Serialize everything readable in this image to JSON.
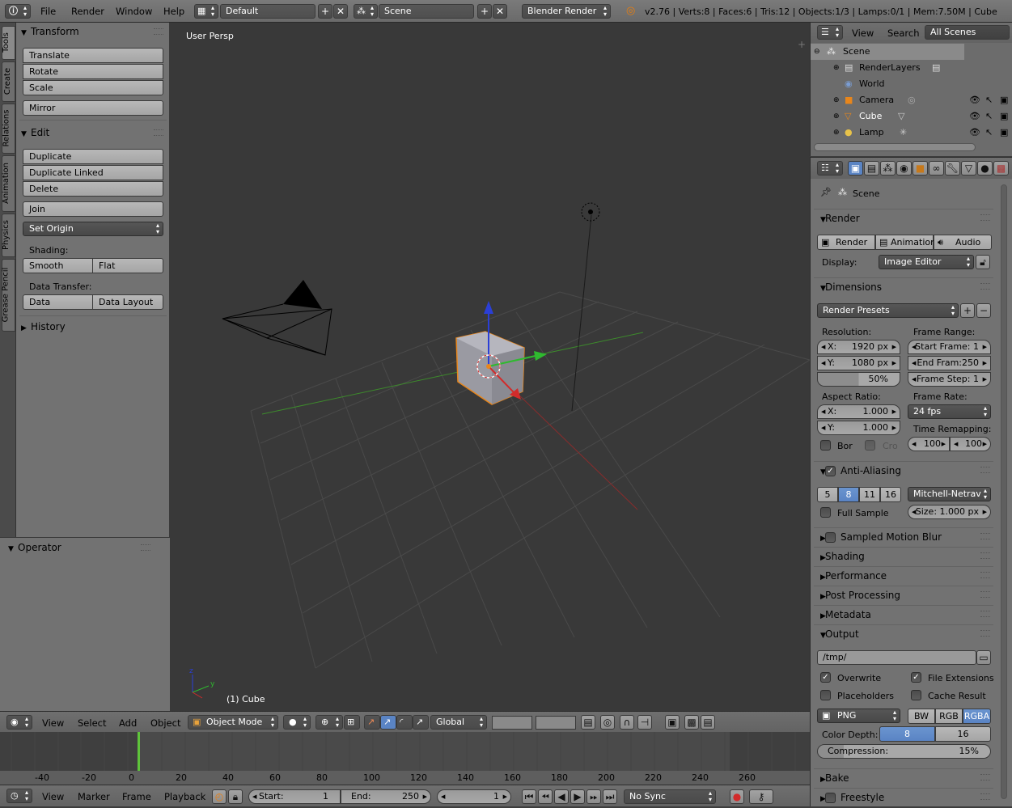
{
  "topbar": {
    "menus": [
      "File",
      "Render",
      "Window",
      "Help"
    ],
    "layout": "Default",
    "scene": "Scene",
    "engine": "Blender Render",
    "stats": "v2.76 | Verts:8 | Faces:6 | Tris:12 | Objects:1/3 | Lamps:0/1 | Mem:7.50M | Cube"
  },
  "left_tabs": [
    "Tools",
    "Create",
    "Relations",
    "Animation",
    "Physics",
    "Grease Pencil"
  ],
  "toolshelf": {
    "transform_title": "Transform",
    "translate": "Translate",
    "rotate": "Rotate",
    "scale": "Scale",
    "mirror": "Mirror",
    "edit_title": "Edit",
    "duplicate": "Duplicate",
    "duplicate_linked": "Duplicate Linked",
    "delete": "Delete",
    "join": "Join",
    "set_origin": "Set Origin",
    "shading_label": "Shading:",
    "smooth": "Smooth",
    "flat": "Flat",
    "data_transfer_label": "Data Transfer:",
    "data": "Data",
    "data_layout": "Data Layout",
    "history_title": "History"
  },
  "operator": {
    "title": "Operator"
  },
  "viewport": {
    "view_name": "User Persp",
    "object_label": "(1) Cube"
  },
  "viewport_header": {
    "menus": [
      "View",
      "Select",
      "Add",
      "Object"
    ],
    "mode": "Object Mode",
    "orientation": "Global"
  },
  "timeline": {
    "ticks": [
      "-40",
      "-20",
      "0",
      "20",
      "40",
      "60",
      "80",
      "100",
      "120",
      "140",
      "160",
      "180",
      "200",
      "220",
      "240",
      "260"
    ],
    "current_frame_value": 1
  },
  "timeline_header": {
    "menus": [
      "View",
      "Marker",
      "Frame",
      "Playback"
    ],
    "start_label": "Start:",
    "start": "1",
    "end_label": "End:",
    "end": "250",
    "current": "1",
    "sync": "No Sync"
  },
  "outliner": {
    "menus": [
      "View",
      "Search"
    ],
    "filter": "All Scenes",
    "items": [
      "Scene",
      "RenderLayers",
      "World",
      "Camera",
      "Cube",
      "Lamp"
    ]
  },
  "properties": {
    "context": "Scene",
    "render": {
      "title": "Render",
      "render_btn": "Render",
      "animation_btn": "Animation",
      "audio_btn": "Audio",
      "display_label": "Display:",
      "display_value": "Image Editor"
    },
    "dimensions": {
      "title": "Dimensions",
      "presets": "Render Presets",
      "resolution_label": "Resolution:",
      "res_x_label": "X:",
      "res_x": "1920 px",
      "res_y_label": "Y:",
      "res_y": "1080 px",
      "res_pct": "50%",
      "frame_range_label": "Frame Range:",
      "start_frame": "Start Frame: 1",
      "end_frame": "End Fram:250",
      "frame_step": "Frame Step:  1",
      "aspect_label": "Aspect Ratio:",
      "aspect_x_label": "X:",
      "aspect_x": "1.000",
      "aspect_y_label": "Y:",
      "aspect_y": "1.000",
      "frame_rate_label": "Frame Rate:",
      "fps": "24 fps",
      "time_remap_label": "Time Remapping:",
      "remap_old": "100",
      "remap_new": "100",
      "bor": "Bor",
      "cro": "Cro"
    },
    "aa": {
      "title": "Anti-Aliasing",
      "samples": [
        "5",
        "8",
        "11",
        "16"
      ],
      "active_sample": "8",
      "filter": "Mitchell-Netrav",
      "full_sample": "Full Sample",
      "size": "Size: 1.000 px"
    },
    "sampled_motion_blur": "Sampled Motion Blur",
    "shading": "Shading",
    "performance": "Performance",
    "post_processing": "Post Processing",
    "metadata": "Metadata",
    "output": {
      "title": "Output",
      "path": "/tmp/",
      "overwrite": "Overwrite",
      "file_extensions": "File Extensions",
      "placeholders": "Placeholders",
      "cache_result": "Cache Result",
      "format": "PNG",
      "color_modes": [
        "BW",
        "RGB",
        "RGBA"
      ],
      "active_color_mode": "RGBA",
      "color_depth_label": "Color Depth:",
      "depths": [
        "8",
        "16"
      ],
      "active_depth": "8",
      "compression": "Compression:",
      "compression_value": "15%"
    },
    "bake": "Bake",
    "freestyle": "Freestyle"
  }
}
